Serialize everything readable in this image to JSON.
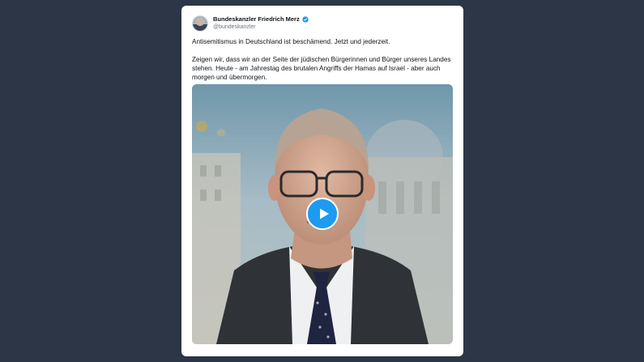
{
  "tweet": {
    "display_name": "Bundeskanzler Friedrich Merz",
    "handle": "@bundeskanzler",
    "verified": true,
    "text_paragraph_1": "Antisemitismus in Deutschland ist beschämend. Jetzt und jederzeit.",
    "text_paragraph_2": "Zeigen wir, dass wir an der Seite der jüdischen Bürgerinnen und Bürger unseres Landes stehen. Heute - am Jahrestag des brutalen Angriffs der Hamas auf Israel - aber auch morgen und übermorgen."
  },
  "video": {
    "play_icon": "play-icon"
  },
  "colors": {
    "page_background": "#2d3646",
    "card_background": "#ffffff",
    "accent": "#1d9bf0",
    "text_primary": "#0f1419",
    "text_secondary": "#6b7682"
  }
}
